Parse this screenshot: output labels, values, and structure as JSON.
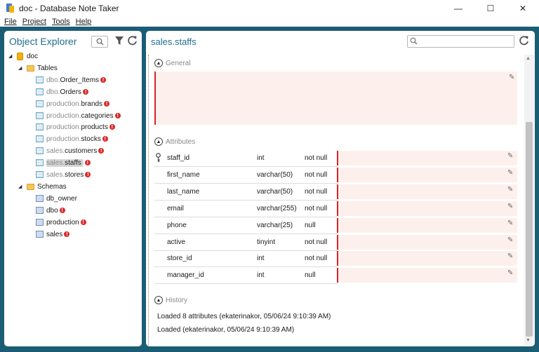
{
  "window": {
    "title": "doc - Database Note Taker",
    "minimize": "—",
    "maximize": "☐",
    "close": "✕"
  },
  "menu": [
    "File",
    "Project",
    "Tools",
    "Help"
  ],
  "explorer": {
    "title": "Object Explorer",
    "db": "doc",
    "tables_label": "Tables",
    "tables": [
      {
        "prefix": "dbo.",
        "name": "Order_Items"
      },
      {
        "prefix": "dbo.",
        "name": "Orders"
      },
      {
        "prefix": "production.",
        "name": "brands"
      },
      {
        "prefix": "production.",
        "name": "categories"
      },
      {
        "prefix": "production.",
        "name": "products"
      },
      {
        "prefix": "production.",
        "name": "stocks"
      },
      {
        "prefix": "sales.",
        "name": "customers"
      },
      {
        "prefix": "sales.",
        "name": "staffs"
      },
      {
        "prefix": "sales.",
        "name": "stores"
      }
    ],
    "schemas_label": "Schemas",
    "schemas": [
      "db_owner",
      "dbo",
      "production",
      "sales"
    ],
    "err_mark": "!"
  },
  "main": {
    "title": "sales.staffs",
    "search_value": "",
    "general_label": "General",
    "attributes_label": "Attributes",
    "history_label": "History",
    "attributes": [
      {
        "name": "staff_id",
        "type": "int",
        "null": "not null"
      },
      {
        "name": "first_name",
        "type": "varchar(50)",
        "null": "not null"
      },
      {
        "name": "last_name",
        "type": "varchar(50)",
        "null": "not null"
      },
      {
        "name": "email",
        "type": "varchar(255)",
        "null": "not null"
      },
      {
        "name": "phone",
        "type": "varchar(25)",
        "null": "null"
      },
      {
        "name": "active",
        "type": "tinyint",
        "null": "not null"
      },
      {
        "name": "store_id",
        "type": "int",
        "null": "not null"
      },
      {
        "name": "manager_id",
        "type": "int",
        "null": "null"
      }
    ],
    "history": [
      "Loaded 8 attributes (ekaterinakor, 05/06/24 9:10:39 AM)",
      "Loaded (ekaterinakor, 05/06/24 9:10:39 AM)"
    ]
  },
  "colors": {
    "accent": "#1e6e8e",
    "frame": "#1b5d74",
    "error": "#d92a2a",
    "note_bg": "#fdf0ec",
    "note_border": "#d8222a"
  }
}
